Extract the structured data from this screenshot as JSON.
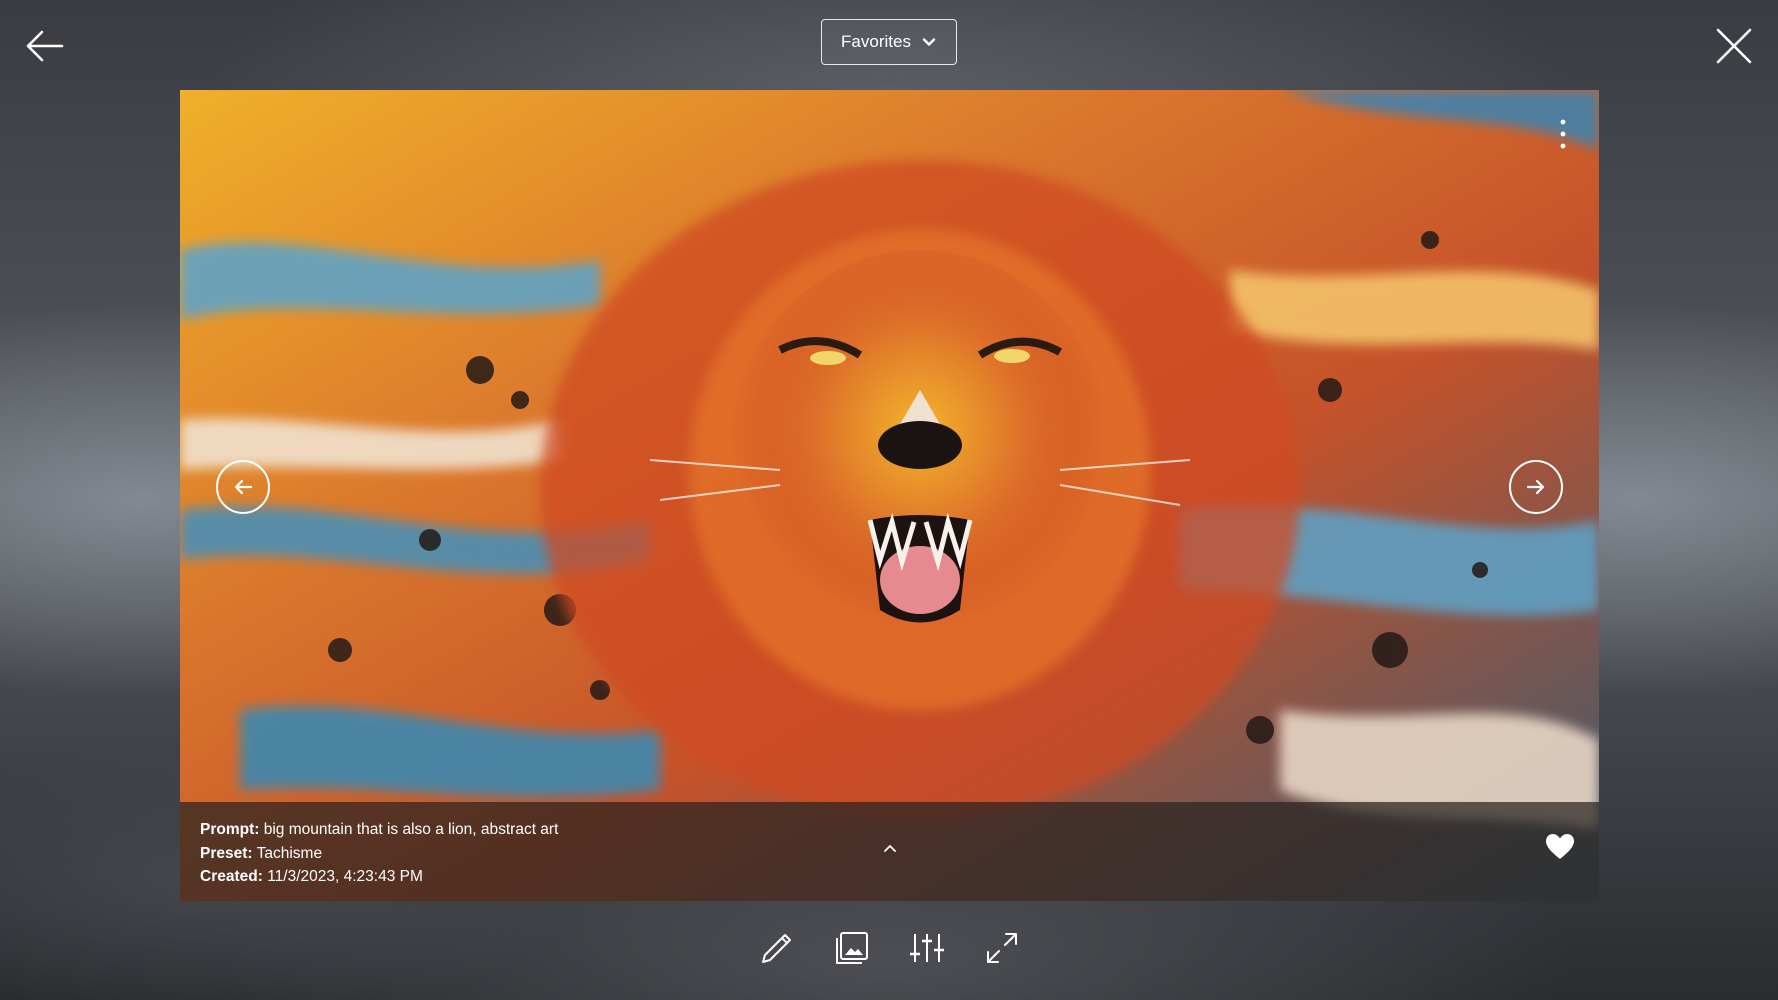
{
  "header": {
    "album_select": {
      "selected": "Favorites"
    }
  },
  "viewer": {
    "artwork_description": "",
    "info": {
      "prompt_label": "Prompt:",
      "prompt_value": "big mountain that is also a lion, abstract art",
      "preset_label": "Preset:",
      "preset_value": "Tachisme",
      "created_label": "Created:",
      "created_value": "11/3/2023, 4:23:43 PM"
    },
    "favorited": true
  },
  "toolbar": {
    "tools": [
      "pencil-icon",
      "image-icon",
      "sliders-icon",
      "expand-icon"
    ]
  },
  "colors": {
    "icon": "#ffffff",
    "info_bar_bg": "#282220",
    "background": "#2b2d31"
  }
}
